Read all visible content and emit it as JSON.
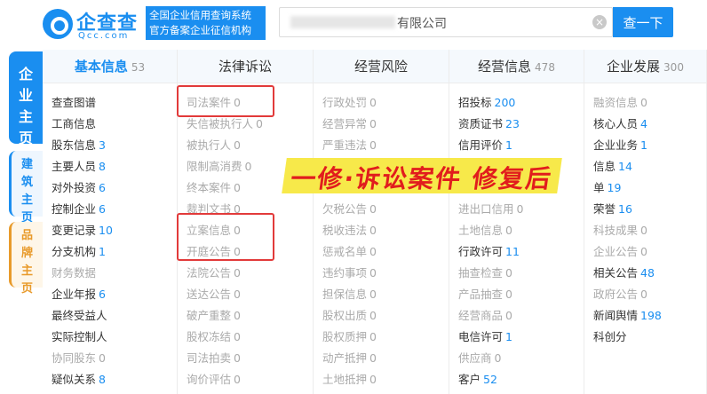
{
  "header": {
    "logo_name": "企查查",
    "logo_domain": "Qcc.com",
    "slogan": [
      "全国企业信用查询系统",
      "官方备案企业征信机构"
    ],
    "search_value": "有限公司",
    "search_button": "查一下"
  },
  "side_tabs": {
    "main": [
      "企",
      "业",
      "主",
      "页"
    ],
    "build": [
      "建",
      "筑",
      "主",
      "页"
    ],
    "brand": [
      "品",
      "牌",
      "主",
      "页"
    ]
  },
  "banner": "一修·诉讼案件 修复后",
  "columns": [
    {
      "title": "基本信息",
      "count": "53",
      "active": true,
      "items": [
        {
          "label": "查查图谱",
          "value": "",
          "on": true
        },
        {
          "label": "工商信息",
          "value": "",
          "on": true
        },
        {
          "label": "股东信息",
          "value": "3",
          "on": true
        },
        {
          "label": "主要人员",
          "value": "8",
          "on": true
        },
        {
          "label": "对外投资",
          "value": "6",
          "on": true
        },
        {
          "label": "控制企业",
          "value": "6",
          "on": true
        },
        {
          "label": "变更记录",
          "value": "10",
          "on": true
        },
        {
          "label": "分支机构",
          "value": "1",
          "on": true
        },
        {
          "label": "财务数据",
          "value": "",
          "on": false
        },
        {
          "label": "企业年报",
          "value": "6",
          "on": true
        },
        {
          "label": "最终受益人",
          "value": "",
          "on": true
        },
        {
          "label": "实际控制人",
          "value": "",
          "on": true
        },
        {
          "label": "协同股东",
          "value": "0",
          "on": false
        },
        {
          "label": "疑似关系",
          "value": "8",
          "on": true
        }
      ]
    },
    {
      "title": "法律诉讼",
      "count": "",
      "active": false,
      "items": [
        {
          "label": "司法案件",
          "value": "0",
          "on": false
        },
        {
          "label": "失信被执行人",
          "value": "0",
          "on": false
        },
        {
          "label": "被执行人",
          "value": "0",
          "on": false
        },
        {
          "label": "限制高消费",
          "value": "0",
          "on": false
        },
        {
          "label": "终本案件",
          "value": "0",
          "on": false
        },
        {
          "label": "裁判文书",
          "value": "0",
          "on": false
        },
        {
          "label": "立案信息",
          "value": "0",
          "on": false
        },
        {
          "label": "开庭公告",
          "value": "0",
          "on": false
        },
        {
          "label": "法院公告",
          "value": "0",
          "on": false
        },
        {
          "label": "送达公告",
          "value": "0",
          "on": false
        },
        {
          "label": "破产重整",
          "value": "0",
          "on": false
        },
        {
          "label": "股权冻结",
          "value": "0",
          "on": false
        },
        {
          "label": "司法拍卖",
          "value": "0",
          "on": false
        },
        {
          "label": "询价评估",
          "value": "0",
          "on": false
        }
      ]
    },
    {
      "title": "经营风险",
      "count": "",
      "active": false,
      "items": [
        {
          "label": "行政处罚",
          "value": "0",
          "on": false
        },
        {
          "label": "经营异常",
          "value": "0",
          "on": false
        },
        {
          "label": "严重违法",
          "value": "0",
          "on": false
        },
        {
          "label": "",
          "value": "",
          "on": false
        },
        {
          "label": "",
          "value": "",
          "on": false
        },
        {
          "label": "欠税公告",
          "value": "0",
          "on": false
        },
        {
          "label": "税收违法",
          "value": "0",
          "on": false
        },
        {
          "label": "惩戒名单",
          "value": "0",
          "on": false
        },
        {
          "label": "违约事项",
          "value": "0",
          "on": false
        },
        {
          "label": "担保信息",
          "value": "0",
          "on": false
        },
        {
          "label": "股权出质",
          "value": "0",
          "on": false
        },
        {
          "label": "股权质押",
          "value": "0",
          "on": false
        },
        {
          "label": "动产抵押",
          "value": "0",
          "on": false
        },
        {
          "label": "土地抵押",
          "value": "0",
          "on": false
        }
      ]
    },
    {
      "title": "经营信息",
      "count": "478",
      "active": false,
      "items": [
        {
          "label": "招投标",
          "value": "200",
          "on": true
        },
        {
          "label": "资质证书",
          "value": "23",
          "on": true
        },
        {
          "label": "信用评价",
          "value": "1",
          "on": true
        },
        {
          "label": "",
          "value": "",
          "on": false
        },
        {
          "label": "",
          "value": "",
          "on": false
        },
        {
          "label": "进出口信用",
          "value": "0",
          "on": false
        },
        {
          "label": "土地信息",
          "value": "0",
          "on": false
        },
        {
          "label": "行政许可",
          "value": "11",
          "on": true
        },
        {
          "label": "抽查检查",
          "value": "0",
          "on": false
        },
        {
          "label": "产品抽查",
          "value": "0",
          "on": false
        },
        {
          "label": "经营商品",
          "value": "0",
          "on": false
        },
        {
          "label": "电信许可",
          "value": "1",
          "on": true
        },
        {
          "label": "供应商",
          "value": "0",
          "on": false
        },
        {
          "label": "客户",
          "value": "52",
          "on": true
        }
      ]
    },
    {
      "title": "企业发展",
      "count": "300",
      "active": false,
      "items": [
        {
          "label": "融资信息",
          "value": "0",
          "on": false
        },
        {
          "label": "核心人员",
          "value": "4",
          "on": true
        },
        {
          "label": "企业业务",
          "value": "1",
          "on": true
        },
        {
          "label": "信息",
          "value": "14",
          "on": true
        },
        {
          "label": "单",
          "value": "19",
          "on": true
        },
        {
          "label": "荣誉",
          "value": "16",
          "on": true
        },
        {
          "label": "科技成果",
          "value": "0",
          "on": false
        },
        {
          "label": "企业公告",
          "value": "0",
          "on": false
        },
        {
          "label": "相关公告",
          "value": "48",
          "on": true
        },
        {
          "label": "政府公告",
          "value": "0",
          "on": false
        },
        {
          "label": "新闻舆情",
          "value": "198",
          "on": true
        },
        {
          "label": "科创分",
          "value": "",
          "on": true
        },
        {
          "label": "",
          "value": "",
          "on": false
        },
        {
          "label": "",
          "value": "",
          "on": false
        }
      ]
    }
  ],
  "colors": {
    "accent": "#1a8ef0",
    "highlight_red": "#e23a3a",
    "banner_yellow": "#f7e94a"
  }
}
